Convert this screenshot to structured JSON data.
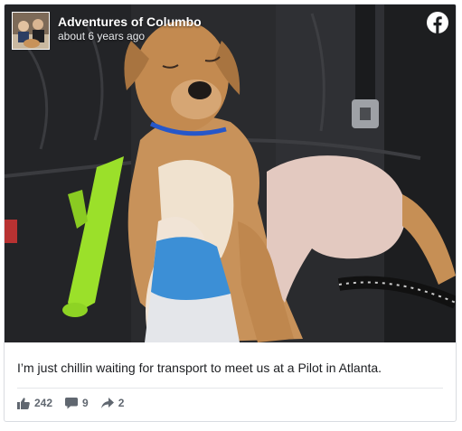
{
  "post": {
    "page_name": "Adventures of Columbo",
    "timestamp": "about 6 years ago",
    "caption": "I’m just chillin waiting for transport to meet us at a Pilot in Atlanta.",
    "stats": {
      "likes": "242",
      "comments": "9",
      "shares": "2"
    }
  },
  "icons": {
    "brand": "facebook-logo-icon",
    "like": "thumbs-up-icon",
    "comment": "speech-bubble-icon",
    "share": "share-arrow-icon"
  },
  "colors": {
    "brand_blue": "#1877f2",
    "text": "#1c1e21",
    "muted": "#606770"
  }
}
